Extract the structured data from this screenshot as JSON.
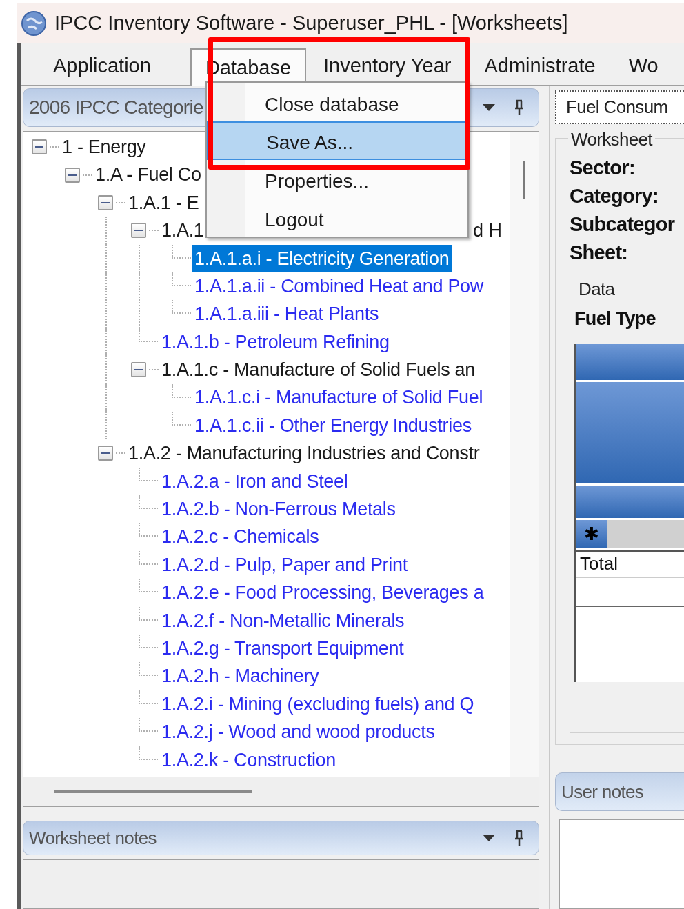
{
  "window": {
    "title": "IPCC Inventory Software - Superuser_PHL - [Worksheets]"
  },
  "menu_bar": [
    {
      "label": "Application",
      "selected": false
    },
    {
      "label": "Database",
      "selected": true
    },
    {
      "label": "Inventory Year",
      "selected": false
    },
    {
      "label": "Administrate",
      "selected": false
    },
    {
      "label": "Wo",
      "selected": false
    }
  ],
  "dropdown": [
    {
      "label": "Close database",
      "selected": false
    },
    {
      "label": "Save As...",
      "selected": true
    },
    {
      "label": "Properties...",
      "selected": false
    },
    {
      "label": "Logout",
      "selected": false
    }
  ],
  "category_panel": {
    "title": "2006 IPCC Categorie",
    "tree": [
      {
        "label": "1 - Energy",
        "selected": false,
        "expanded": true,
        "children": [
          {
            "label": "1.A - Fuel Co",
            "selected": false,
            "expanded": true,
            "children": [
              {
                "label": "1.A.1 - E",
                "selected": false,
                "expanded": true,
                "children": [
                  {
                    "label": "1.A.1",
                    "tail": "d H",
                    "selected": false,
                    "expanded": true,
                    "children": [
                      {
                        "label": "1.A.1.a.i - Electricity Generation",
                        "selected": true
                      },
                      {
                        "label": "1.A.1.a.ii - Combined Heat and Pow",
                        "selected": false
                      },
                      {
                        "label": "1.A.1.a.iii - Heat Plants",
                        "selected": false
                      }
                    ]
                  },
                  {
                    "label": "1.A.1.b - Petroleum Refining",
                    "selected": false
                  },
                  {
                    "label": "1.A.1.c - Manufacture of Solid Fuels an",
                    "selected": false,
                    "expanded": true,
                    "children": [
                      {
                        "label": "1.A.1.c.i - Manufacture of Solid Fuel",
                        "selected": false
                      },
                      {
                        "label": "1.A.1.c.ii - Other Energy Industries",
                        "selected": false
                      }
                    ]
                  }
                ]
              },
              {
                "label": "1.A.2 - Manufacturing Industries and Constr",
                "selected": false,
                "expanded": true,
                "children": [
                  {
                    "label": "1.A.2.a - Iron and Steel",
                    "selected": false
                  },
                  {
                    "label": "1.A.2.b - Non-Ferrous Metals",
                    "selected": false
                  },
                  {
                    "label": "1.A.2.c - Chemicals",
                    "selected": false
                  },
                  {
                    "label": "1.A.2.d - Pulp, Paper and Print",
                    "selected": false
                  },
                  {
                    "label": "1.A.2.e - Food Processing, Beverages a",
                    "selected": false
                  },
                  {
                    "label": "1.A.2.f - Non-Metallic Minerals",
                    "selected": false
                  },
                  {
                    "label": "1.A.2.g - Transport Equipment",
                    "selected": false
                  },
                  {
                    "label": "1.A.2.h - Machinery",
                    "selected": false
                  },
                  {
                    "label": "1.A.2.i - Mining (excluding fuels) and Q",
                    "selected": false
                  },
                  {
                    "label": "1.A.2.j - Wood and wood products",
                    "selected": false
                  },
                  {
                    "label": "1.A.2.k - Construction",
                    "selected": false
                  }
                ]
              }
            ]
          }
        ]
      }
    ]
  },
  "worksheet_notes": {
    "title": "Worksheet notes"
  },
  "worksheet_tab": {
    "label": "Fuel Consum"
  },
  "worksheet_group": {
    "legend": "Worksheet",
    "fields": [
      "Sector:",
      "Category:",
      "Subcategor",
      "Sheet:"
    ]
  },
  "data_group": {
    "legend": "Data",
    "column_label": "Fuel Type",
    "new_row_marker": "✱",
    "rows": [
      "Total"
    ]
  },
  "user_notes": {
    "title": "User notes"
  }
}
